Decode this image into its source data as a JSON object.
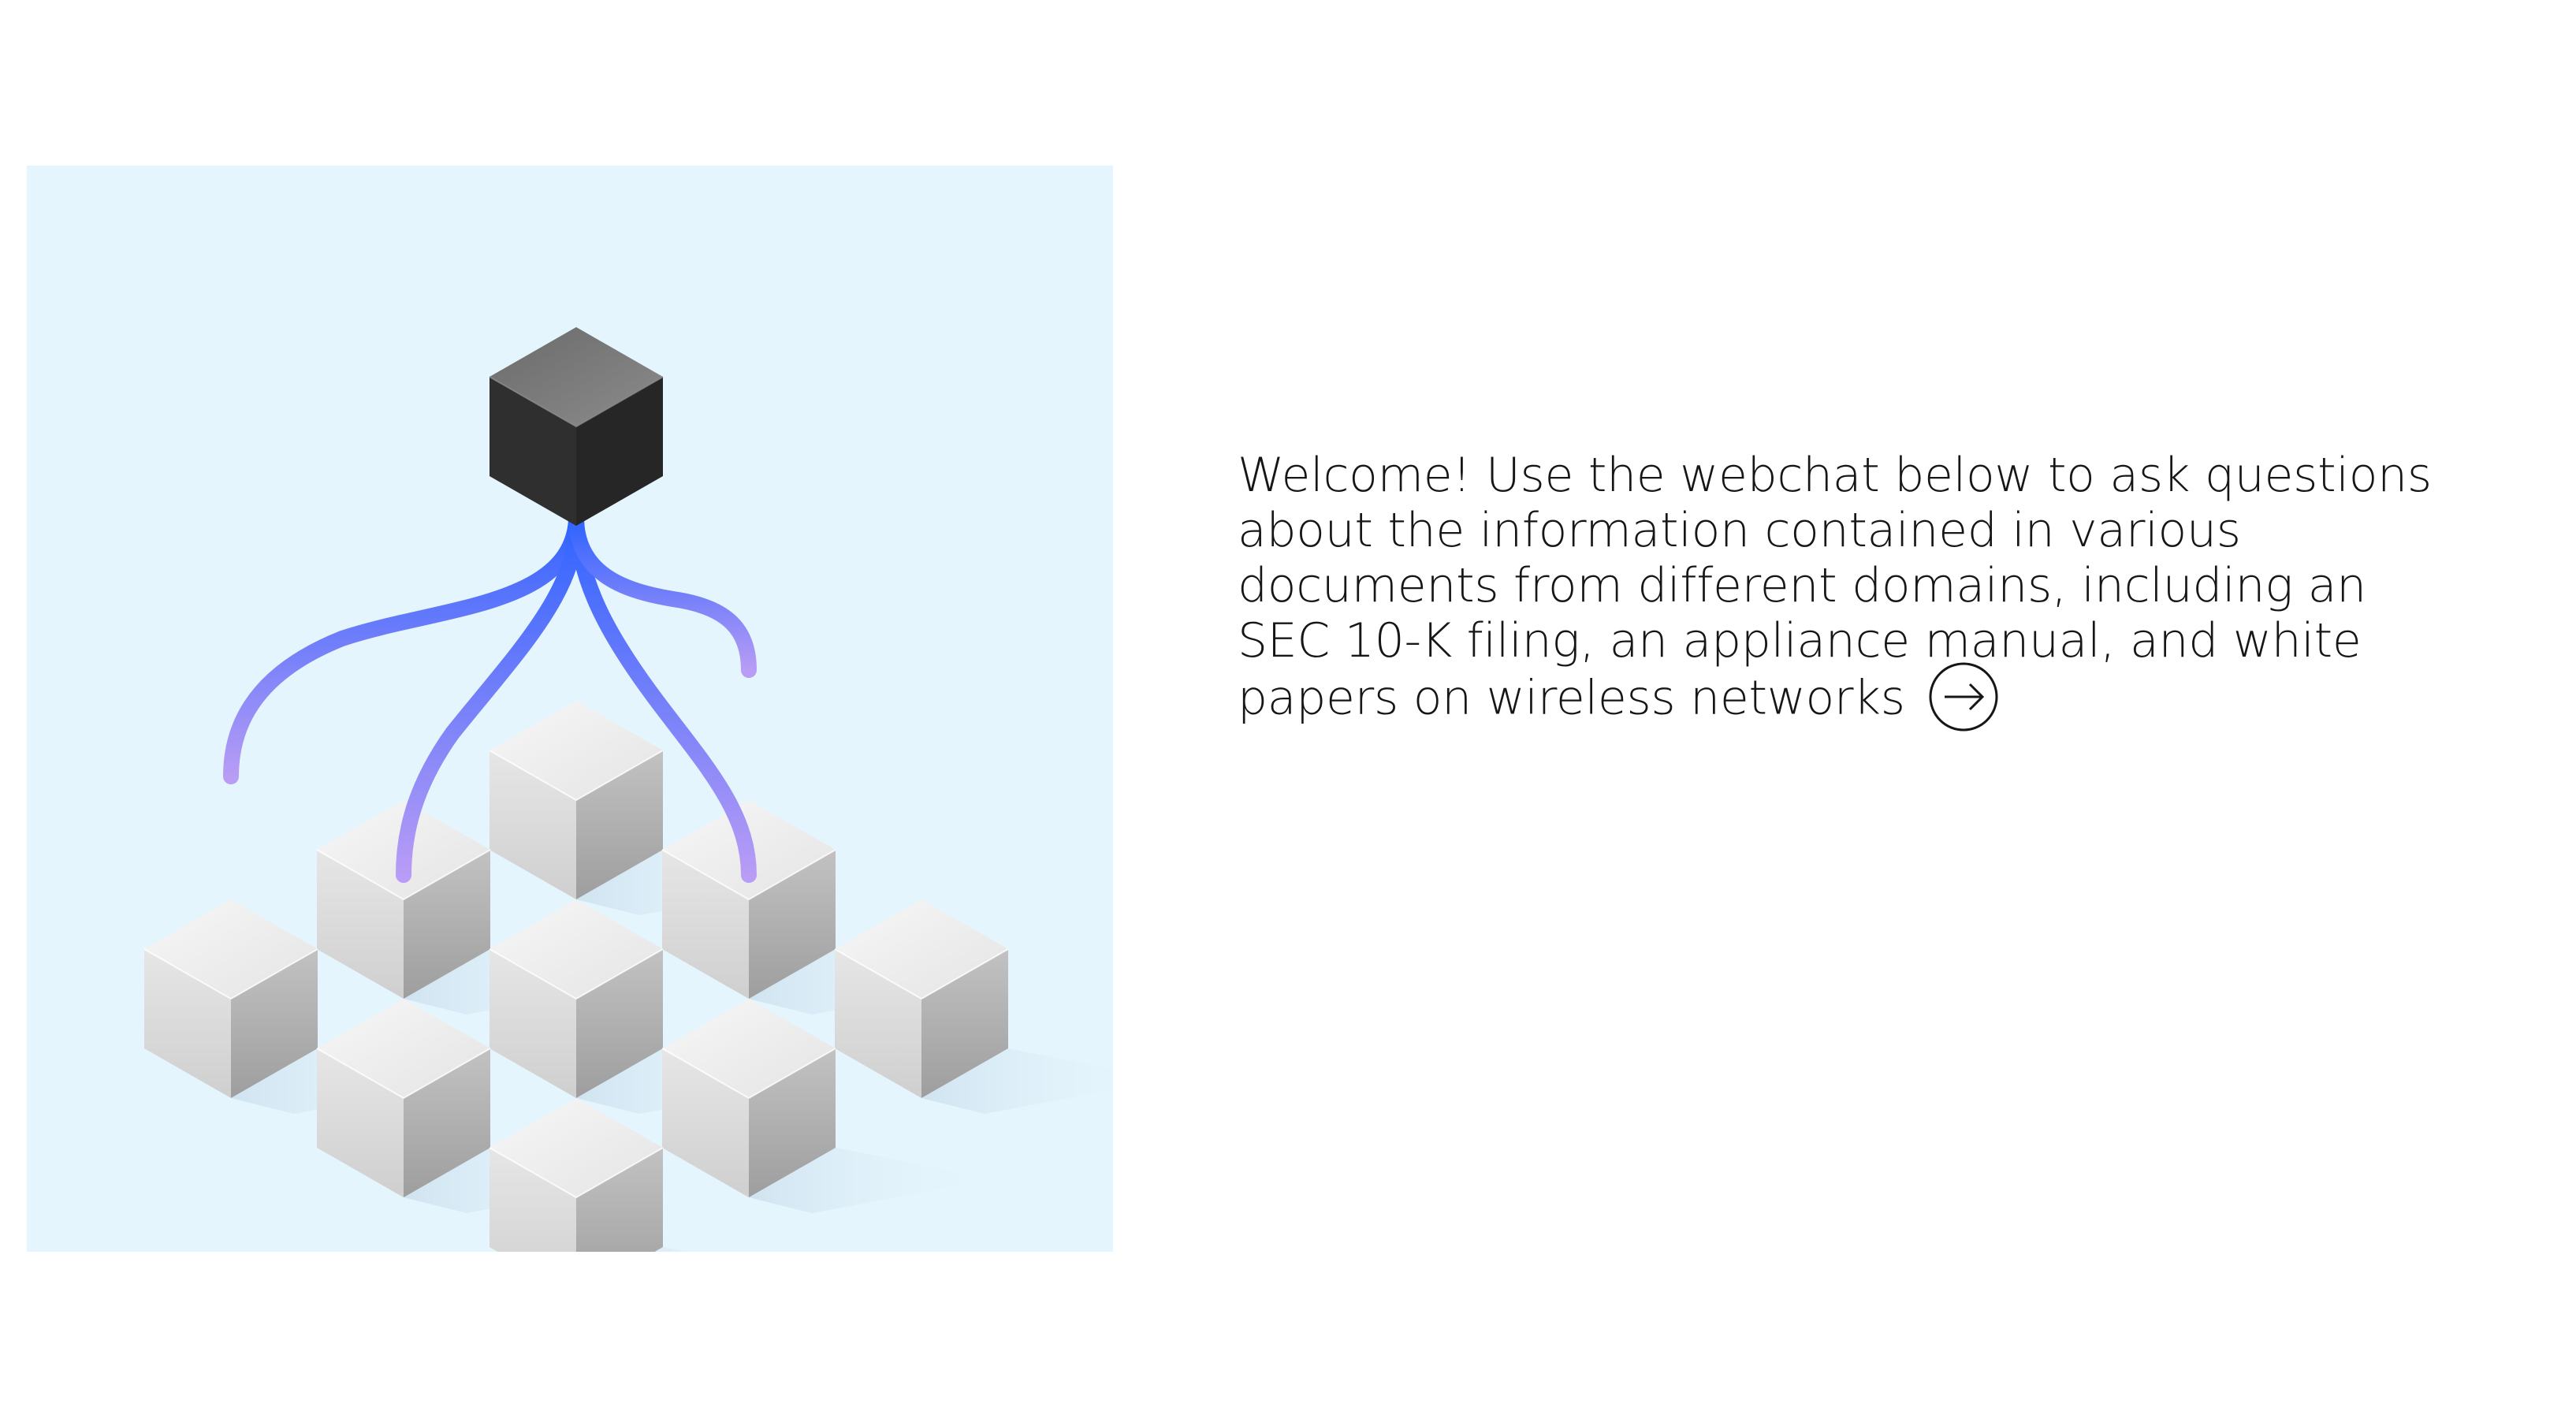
{
  "welcome": {
    "lines": [
      "Welcome! Use the webchat below to ask questions",
      "about the information contained in various",
      "documents from different domains, including an",
      "SEC 10-K filing, an appliance manual, and white",
      "papers on wireless networks"
    ],
    "link_icon": "arrow-right-circle-icon"
  },
  "illustration": {
    "name": "network-of-cubes",
    "background_color": "#e5f5fd",
    "hub_color": "#3a3a3a",
    "connector_colors": [
      "#3366ff",
      "#b08ff2"
    ]
  }
}
